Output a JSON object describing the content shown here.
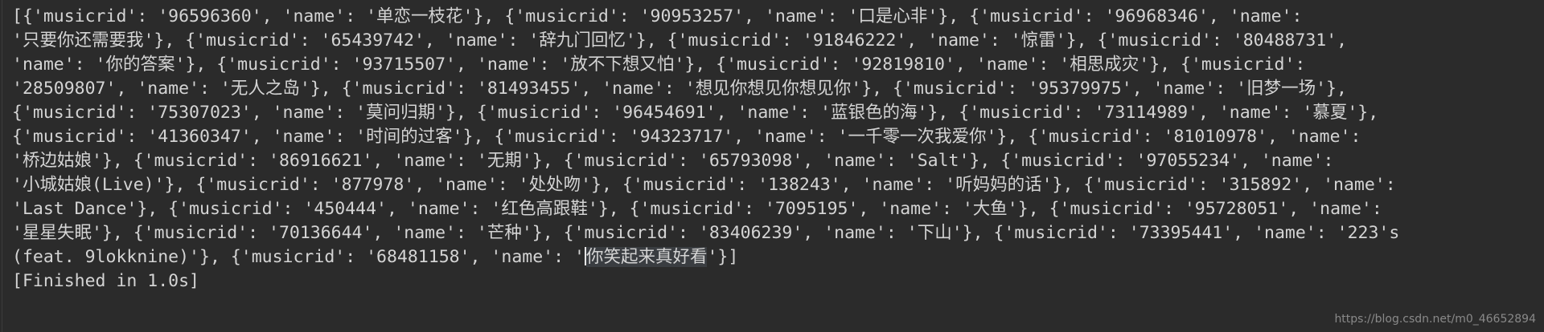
{
  "console": {
    "lines": [
      "[{'musicrid': '96596360', 'name': '单恋一枝花'}, {'musicrid': '90953257', 'name': '口是心非'}, {'musicrid': '96968346', 'name':",
      "'只要你还需要我'}, {'musicrid': '65439742', 'name': '辞九门回忆'}, {'musicrid': '91846222', 'name': '惊雷'}, {'musicrid': '80488731',",
      "'name': '你的答案'}, {'musicrid': '93715507', 'name': '放不下想又怕'}, {'musicrid': '92819810', 'name': '相思成灾'}, {'musicrid':",
      "'28509807', 'name': '无人之岛'}, {'musicrid': '81493455', 'name': '想见你想见你想见你'}, {'musicrid': '95379975', 'name': '旧梦一场'},",
      "{'musicrid': '75307023', 'name': '莫问归期'}, {'musicrid': '96454691', 'name': '蓝银色的海'}, {'musicrid': '73114989', 'name': '慕夏'},",
      "{'musicrid': '41360347', 'name': '时间的过客'}, {'musicrid': '94323717', 'name': '一千零一次我爱你'}, {'musicrid': '81010978', 'name':",
      "'桥边姑娘'}, {'musicrid': '86916621', 'name': '无期'}, {'musicrid': '65793098', 'name': 'Salt'}, {'musicrid': '97055234', 'name':",
      "'小城姑娘(Live)'}, {'musicrid': '877978', 'name': '处处吻'}, {'musicrid': '138243', 'name': '听妈妈的话'}, {'musicrid': '315892', 'name':",
      "'Last Dance'}, {'musicrid': '450444', 'name': '红色高跟鞋'}, {'musicrid': '7095195', 'name': '大鱼'}, {'musicrid': '95728051', 'name':",
      "'星星失眠'}, {'musicrid': '70136644', 'name': '芒种'}, {'musicrid': '83406239', 'name': '下山'}, {'musicrid': '73395441', 'name': '223's"
    ],
    "last_line_prefix": "(feat. 9lokknine)'}, {'musicrid': '68481158', 'name': '",
    "last_line_highlight": "你笑起来真好看",
    "last_line_suffix": "'}]",
    "status": "[Finished in 1.0s]"
  },
  "watermark": "https://blog.csdn.net/m0_46652894",
  "colors": {
    "background": "#2b2b2b",
    "text": "#d4d4d4"
  }
}
